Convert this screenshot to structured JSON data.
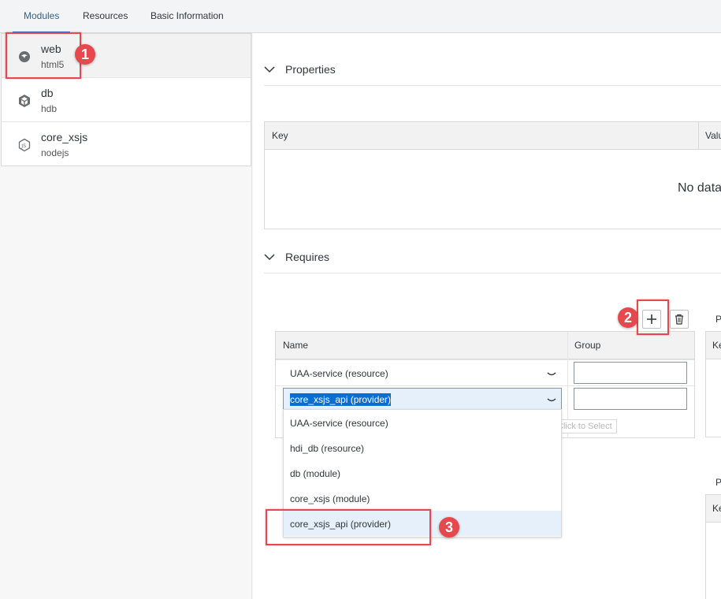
{
  "tabs": [
    {
      "label": "Modules",
      "active": true
    },
    {
      "label": "Resources",
      "active": false
    },
    {
      "label": "Basic Information",
      "active": false
    }
  ],
  "modules": [
    {
      "name": "web",
      "type": "html5",
      "icon": "html5-globe-icon",
      "selected": true
    },
    {
      "name": "db",
      "type": "hdb",
      "icon": "database-cube-icon",
      "selected": false
    },
    {
      "name": "core_xsjs",
      "type": "nodejs",
      "icon": "nodejs-hexagon-icon",
      "selected": false
    }
  ],
  "properties": {
    "title": "Properties",
    "columns": [
      "Key",
      "Valu"
    ],
    "empty_text": "No data"
  },
  "requires": {
    "title": "Requires",
    "columns": [
      "Name",
      "Group"
    ],
    "rows": [
      {
        "name": "UAA-service (resource)",
        "group": ""
      },
      {
        "name": "core_xsjs_api (provider)",
        "group": ""
      }
    ],
    "dropdown_options": [
      "UAA-service (resource)",
      "hdi_db (resource)",
      "db (module)",
      "core_xsjs (module)",
      "core_xsjs_api (provider)"
    ],
    "selected_option": "core_xsjs_api (provider)",
    "tooltip": "Click to Select"
  },
  "side_tables": [
    {
      "label": "P",
      "column": "Ke"
    },
    {
      "label": "P",
      "column": "Ke"
    }
  ],
  "annotations": [
    "1",
    "2",
    "3"
  ],
  "colors": {
    "annotation_red": "#e5484d",
    "selection_blue": "#0a6ed1",
    "tab_active": "#346187"
  }
}
